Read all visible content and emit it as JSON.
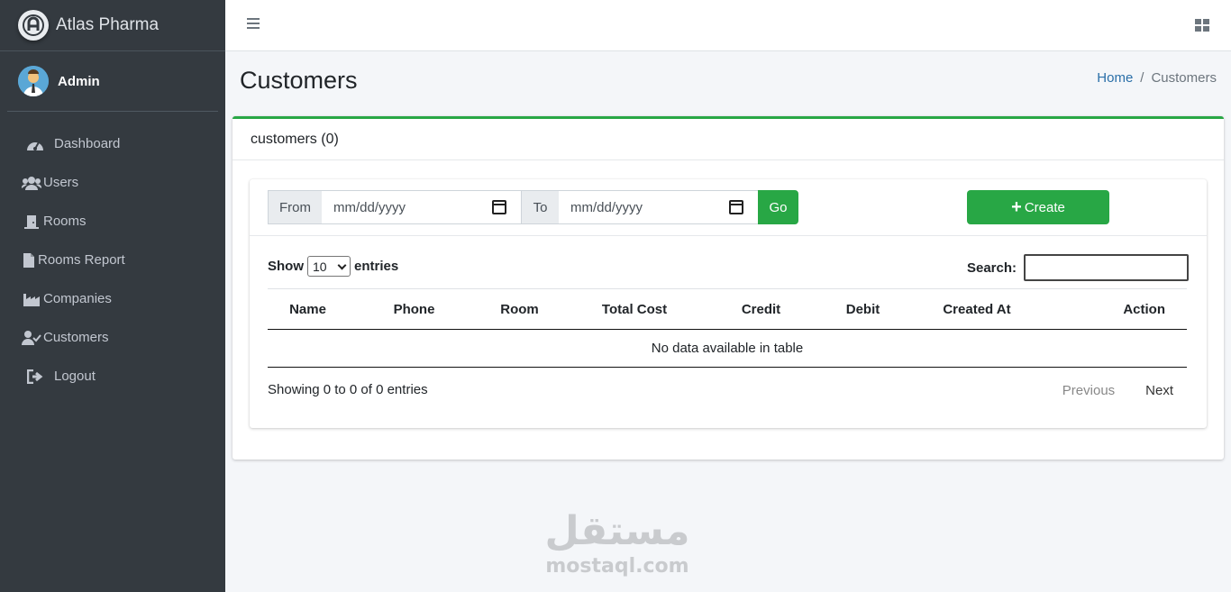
{
  "brand": {
    "name": "Atlas Pharma"
  },
  "user": {
    "name": "Admin"
  },
  "sidebar": {
    "items": [
      {
        "label": "Dashboard",
        "icon": "dashboard-icon"
      },
      {
        "label": "Users",
        "icon": "users-icon"
      },
      {
        "label": "Rooms",
        "icon": "door-icon"
      },
      {
        "label": "Rooms Report",
        "icon": "file-icon"
      },
      {
        "label": "Companies",
        "icon": "industry-icon"
      },
      {
        "label": "Customers",
        "icon": "user-check-icon"
      },
      {
        "label": "Logout",
        "icon": "sign-out-icon"
      }
    ]
  },
  "header": {
    "title": "Customers",
    "breadcrumb": {
      "home": "Home",
      "separator": "/",
      "current": "Customers"
    }
  },
  "card": {
    "title": "customers (0)",
    "filter": {
      "from_label": "From",
      "from_placeholder": "mm/dd/yyyy",
      "to_label": "To",
      "to_placeholder": "mm/dd/yyyy",
      "go_label": "Go"
    },
    "create_label": "Create",
    "table": {
      "show_label": "Show",
      "entries_value": "10",
      "entries_label": "entries",
      "search_label": "Search:",
      "search_value": "",
      "columns": [
        "Name",
        "Phone",
        "Room",
        "Total Cost",
        "Credit",
        "Debit",
        "Created At",
        "Action"
      ],
      "empty_message": "No data available in table",
      "info": "Showing 0 to 0 of 0 entries",
      "previous": "Previous",
      "next": "Next"
    }
  },
  "watermark": {
    "arabic": "مستقل",
    "latin": "mostaql.com"
  },
  "colors": {
    "sidebar": "#343a40",
    "accent": "#28a745",
    "link": "#2a6fa8"
  }
}
